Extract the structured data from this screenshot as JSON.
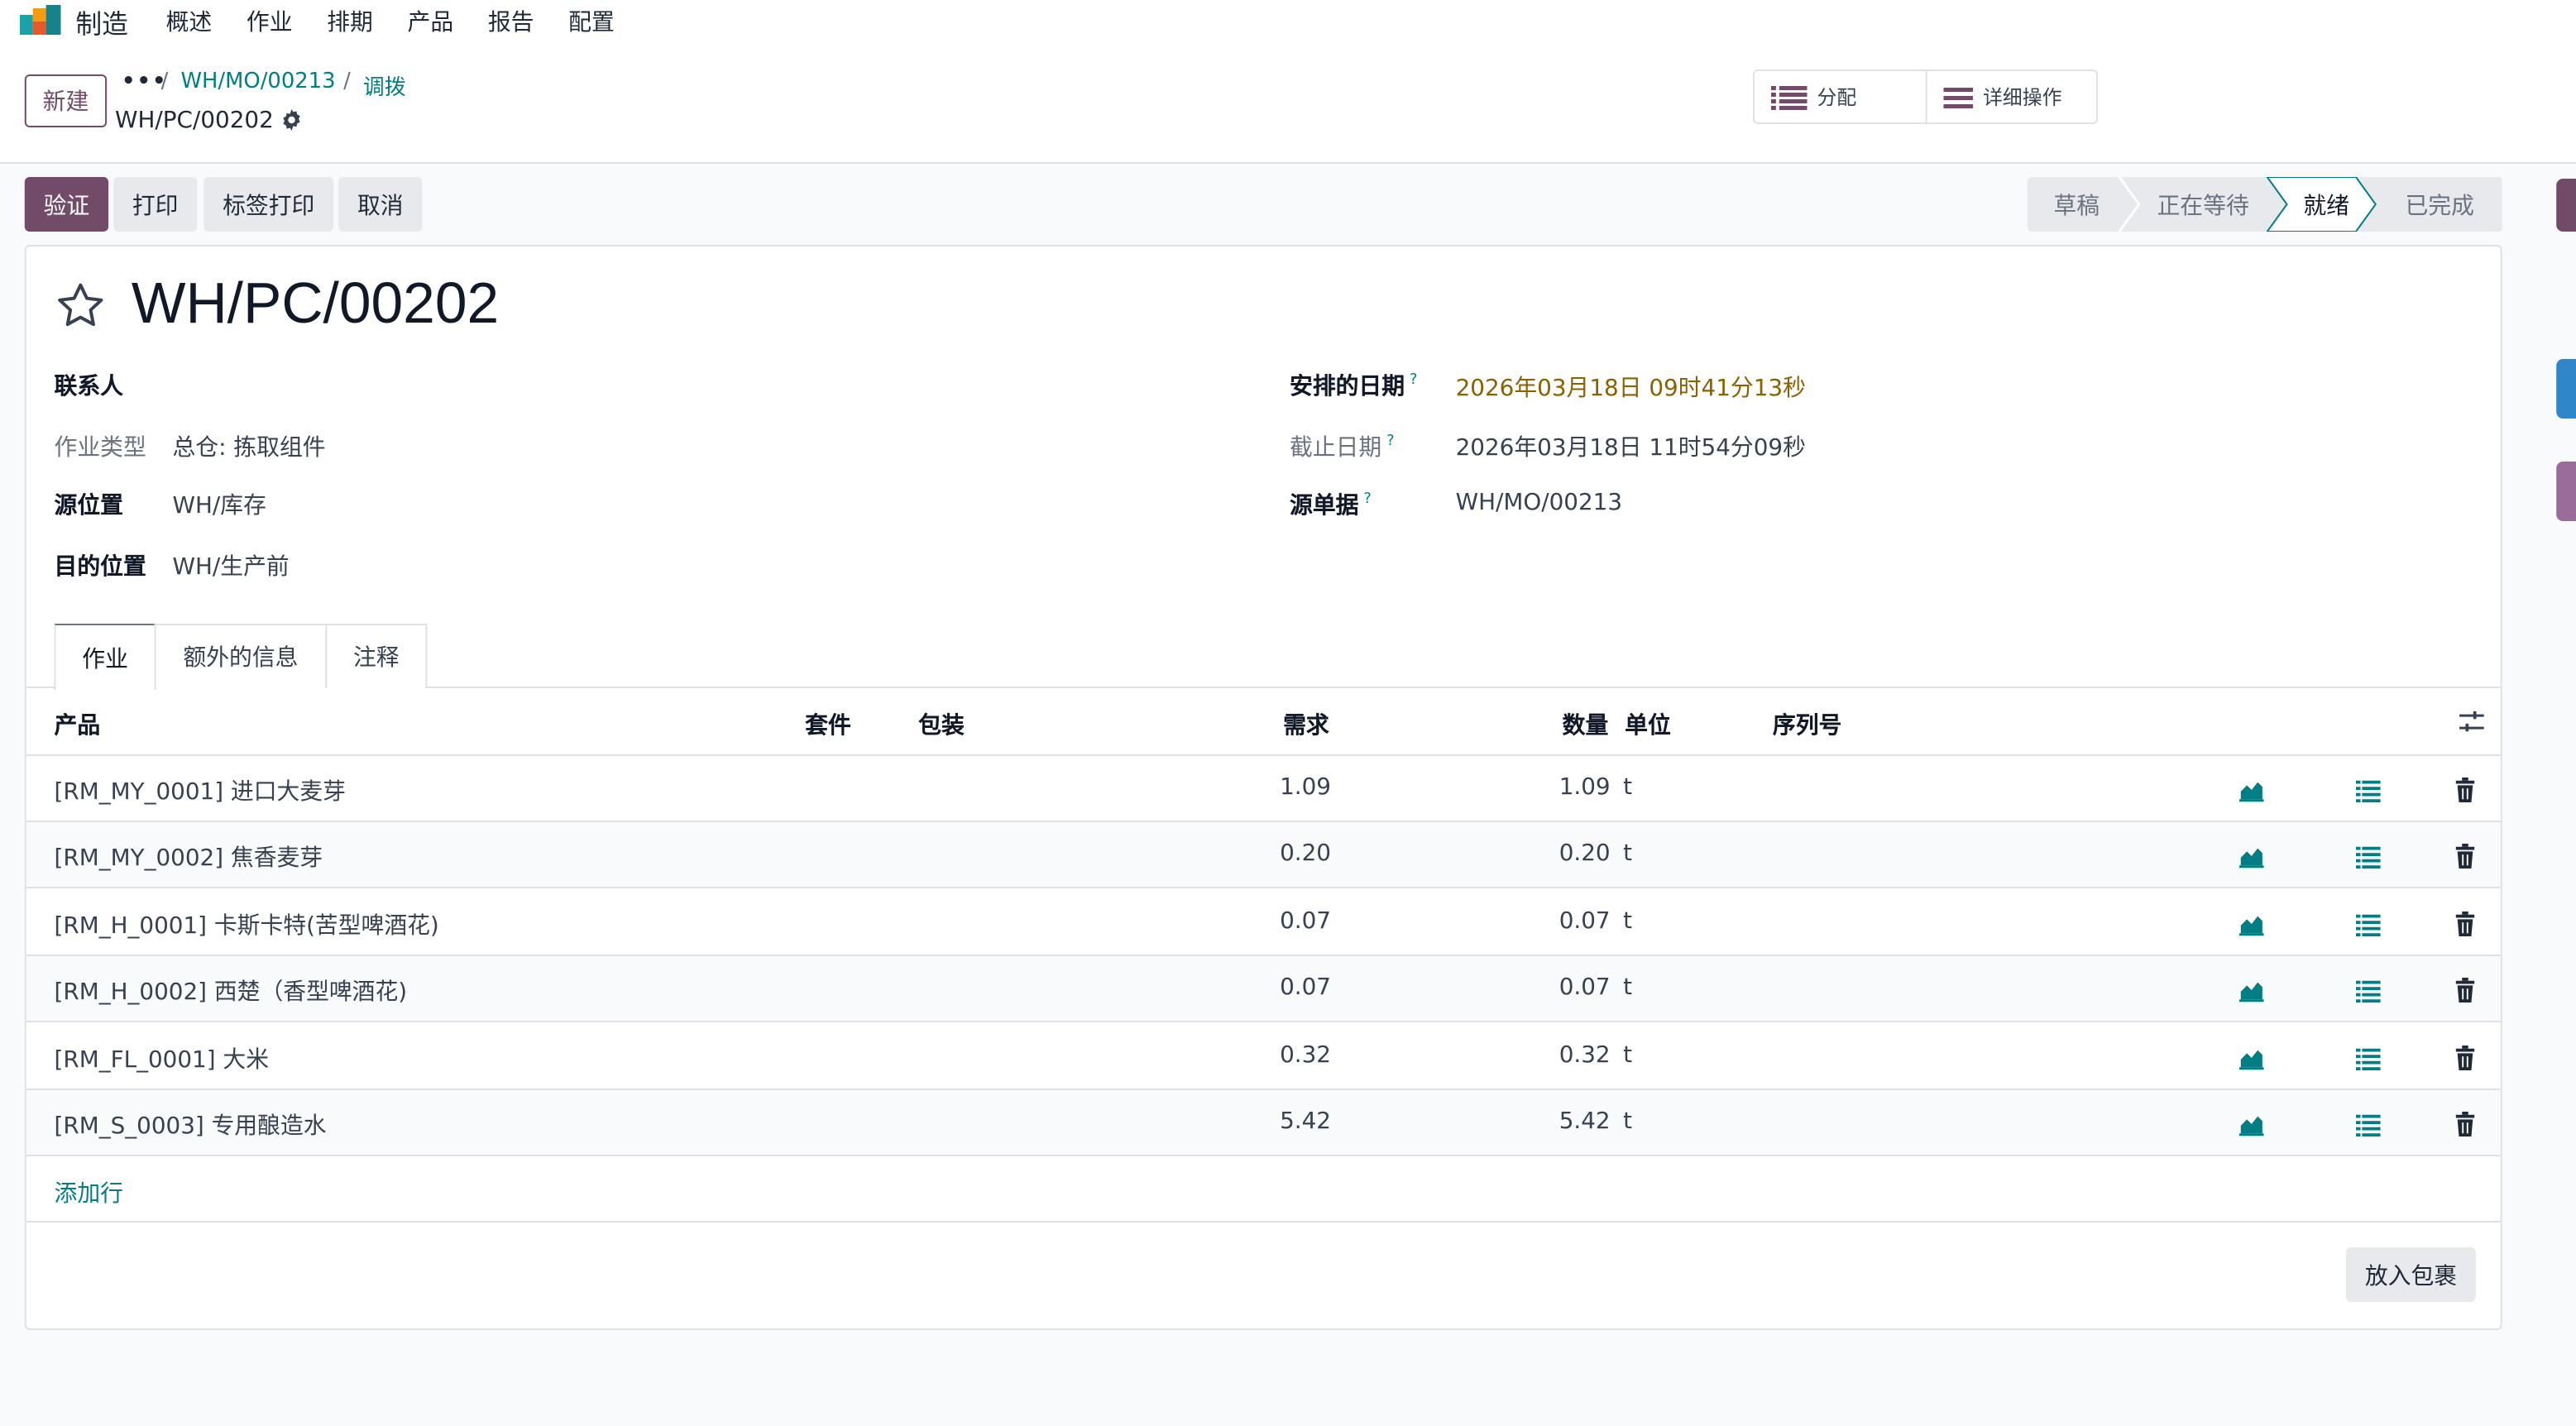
{
  "navbar": {
    "app_name": "制造",
    "menu": [
      "概述",
      "作业",
      "排期",
      "产品",
      "报告",
      "配置"
    ]
  },
  "control": {
    "new_label": "新建",
    "breadcrumb": {
      "dots": "•••",
      "sep": "/",
      "mo": "WH/MO/00213",
      "transfers": "调拨",
      "current": "WH/PC/00202"
    },
    "allocation_label": "分配",
    "detailed_ops_label": "详细操作"
  },
  "actions": {
    "validate": "验证",
    "print": "打印",
    "label_print": "标签打印",
    "cancel": "取消"
  },
  "status": {
    "draft": "草稿",
    "waiting": "正在等待",
    "ready": "就绪",
    "done": "已完成",
    "active": "就绪"
  },
  "form": {
    "title": "WH/PC/00202",
    "contact_label": "联系人",
    "op_type_label": "作业类型",
    "op_type_value": "总仓: 拣取组件",
    "source_loc_label": "源位置",
    "source_loc_value": "WH/库存",
    "dest_loc_label": "目的位置",
    "dest_loc_value": "WH/生产前",
    "scheduled_label": "安排的日期",
    "scheduled_value": "2026年03月18日 09时41分13秒",
    "deadline_label": "截止日期",
    "deadline_value": "2026年03月18日 11时54分09秒",
    "origin_label": "源单据",
    "origin_value": "WH/MO/00213",
    "help_mark": "?"
  },
  "tabs": [
    "作业",
    "额外的信息",
    "注释"
  ],
  "table": {
    "headers": {
      "product": "产品",
      "kit": "套件",
      "package": "包装",
      "demand": "需求",
      "quantity": "数量",
      "uom": "单位",
      "lot": "序列号"
    },
    "rows": [
      {
        "product": "[RM_MY_0001] 进口大麦芽",
        "demand": "1.09",
        "quantity": "1.09",
        "uom": "t"
      },
      {
        "product": "[RM_MY_0002] 焦香麦芽",
        "demand": "0.20",
        "quantity": "0.20",
        "uom": "t"
      },
      {
        "product": "[RM_H_0001] 卡斯卡特(苦型啤酒花)",
        "demand": "0.07",
        "quantity": "0.07",
        "uom": "t"
      },
      {
        "product": "[RM_H_0002] 西楚（香型啤酒花)",
        "demand": "0.07",
        "quantity": "0.07",
        "uom": "t"
      },
      {
        "product": "[RM_FL_0001] 大米",
        "demand": "0.32",
        "quantity": "0.32",
        "uom": "t"
      },
      {
        "product": "[RM_S_0003] 专用酿造水",
        "demand": "5.42",
        "quantity": "5.42",
        "uom": "t"
      }
    ],
    "add_line": "添加行",
    "put_in_pack": "放入包裹"
  },
  "colors": {
    "brand": "#714b67",
    "link": "#017e84",
    "warning": "#8a6100"
  }
}
